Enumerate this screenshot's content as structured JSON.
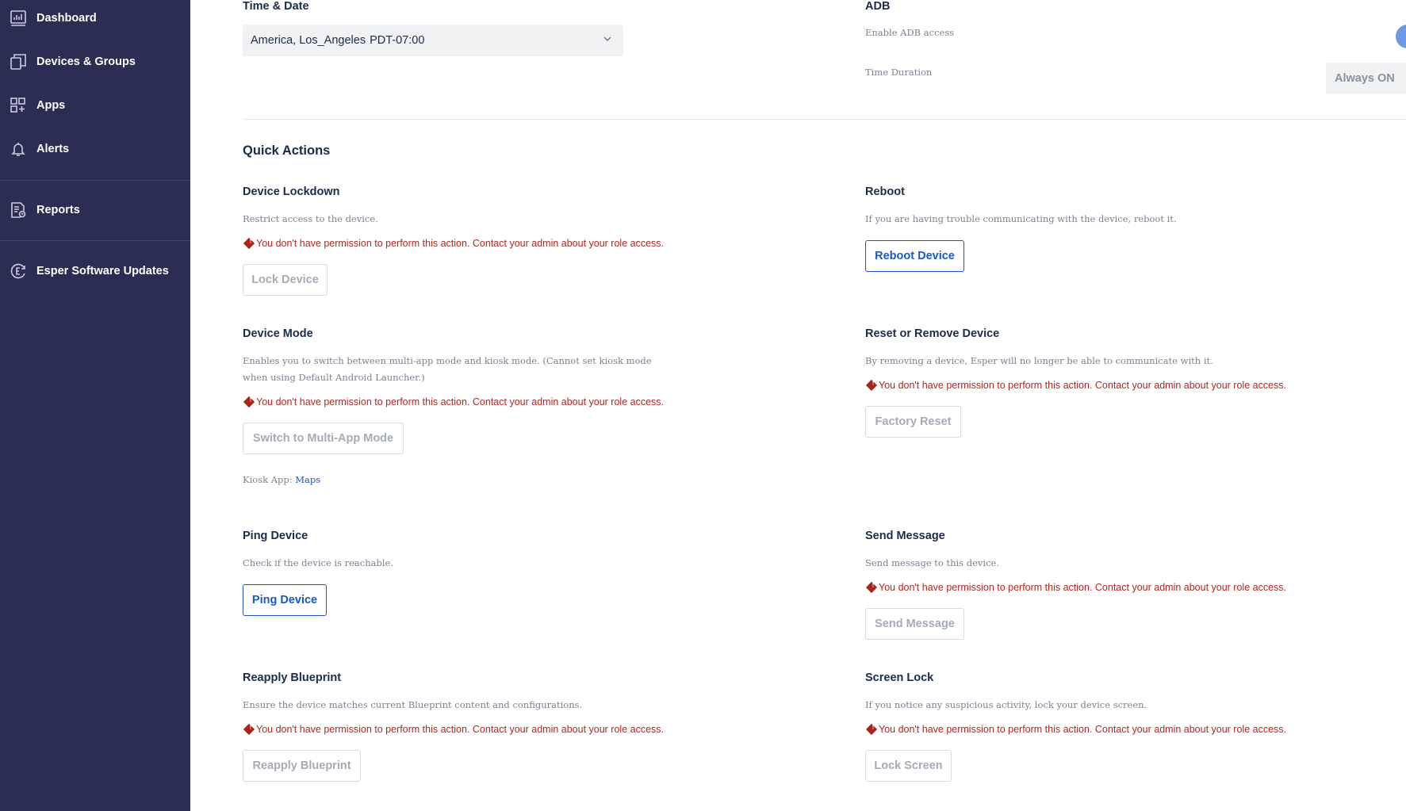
{
  "sidebar": {
    "items": [
      {
        "label": "Dashboard",
        "icon": "dashboard-icon"
      },
      {
        "label": "Devices & Groups",
        "icon": "devices-icon"
      },
      {
        "label": "Apps",
        "icon": "apps-icon"
      },
      {
        "label": "Alerts",
        "icon": "bell-icon"
      },
      {
        "label": "Reports",
        "icon": "reports-icon"
      },
      {
        "label": "Esper Software Updates",
        "icon": "esper-updates-icon"
      }
    ]
  },
  "time_date": {
    "title": "Time & Date",
    "timezone": "America, Los_Angeles",
    "offset": "PDT-07:00"
  },
  "adb": {
    "title": "ADB",
    "enable_label": "Enable ADB access",
    "duration_label": "Time Duration",
    "duration_value": "Always ON"
  },
  "quick_actions": {
    "title": "Quick Actions",
    "permission_error": "You don't have permission to perform this action. Contact your admin about your role access.",
    "device_lockdown": {
      "title": "Device Lockdown",
      "desc": "Restrict access to the device.",
      "button": "Lock Device"
    },
    "reboot": {
      "title": "Reboot",
      "desc": "If you are having trouble communicating with the device, reboot it.",
      "button": "Reboot Device"
    },
    "device_mode": {
      "title": "Device Mode",
      "desc_line1": "Enables you to switch between multi-app mode and kiosk mode. (Cannot set kiosk mode",
      "desc_line2": "when using Default Android Launcher.)",
      "button": "Switch to Multi-App Mode",
      "kiosk_label": "Kiosk App: ",
      "kiosk_app": "Maps"
    },
    "reset_remove": {
      "title": "Reset or Remove Device",
      "desc": "By removing a device, Esper will no longer be able to communicate with it.",
      "button": "Factory Reset"
    },
    "ping": {
      "title": "Ping Device",
      "desc": "Check if the device is reachable.",
      "button": "Ping Device"
    },
    "send_message": {
      "title": "Send Message",
      "desc": "Send message to this device.",
      "button": "Send Message"
    },
    "reapply_blueprint": {
      "title": "Reapply Blueprint",
      "desc": "Ensure the device matches current Blueprint content and configurations.",
      "button": "Reapply Blueprint"
    },
    "screen_lock": {
      "title": "Screen Lock",
      "desc": "If you notice any suspicious activity, lock your device screen.",
      "button": "Lock Screen"
    }
  },
  "colors": {
    "sidebar_bg": "#2b2d52",
    "primary": "#1b58c4",
    "error": "#b3261e"
  }
}
